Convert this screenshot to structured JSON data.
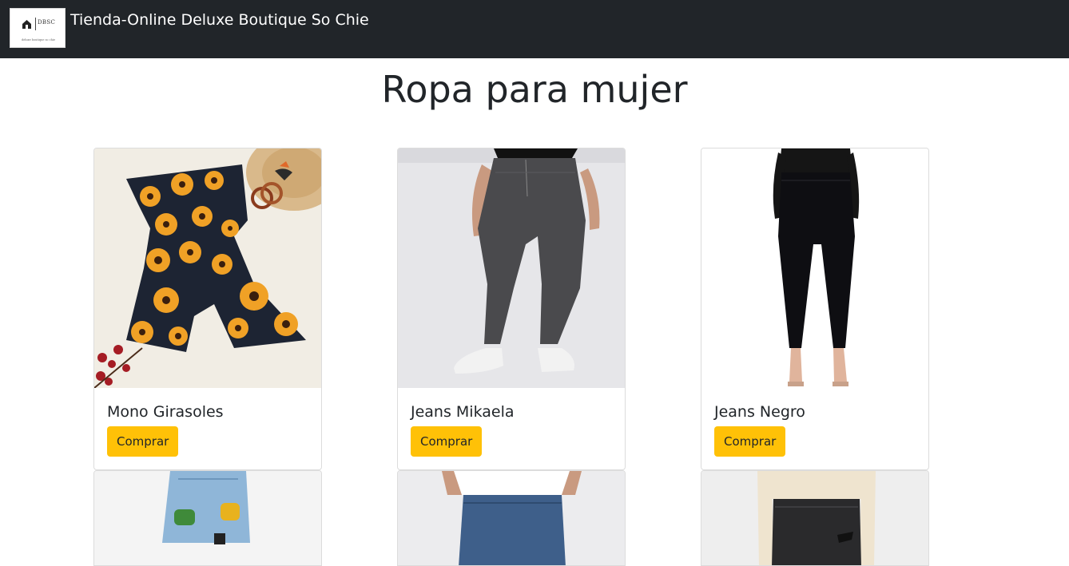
{
  "navbar": {
    "logo": {
      "abbr": "DBSC",
      "tagline": "deluxe boutique so chie"
    },
    "brand": "Tienda-Online Deluxe Boutique So Chie"
  },
  "page": {
    "title": "Ropa para mujer"
  },
  "products": [
    {
      "name": "Mono Girasoles",
      "button": "Comprar"
    },
    {
      "name": "Jeans Mikaela",
      "button": "Comprar"
    },
    {
      "name": "Jeans Negro",
      "button": "Comprar"
    }
  ],
  "colors": {
    "navbar": "#212529",
    "button": "#ffc107",
    "text": "#212529"
  }
}
